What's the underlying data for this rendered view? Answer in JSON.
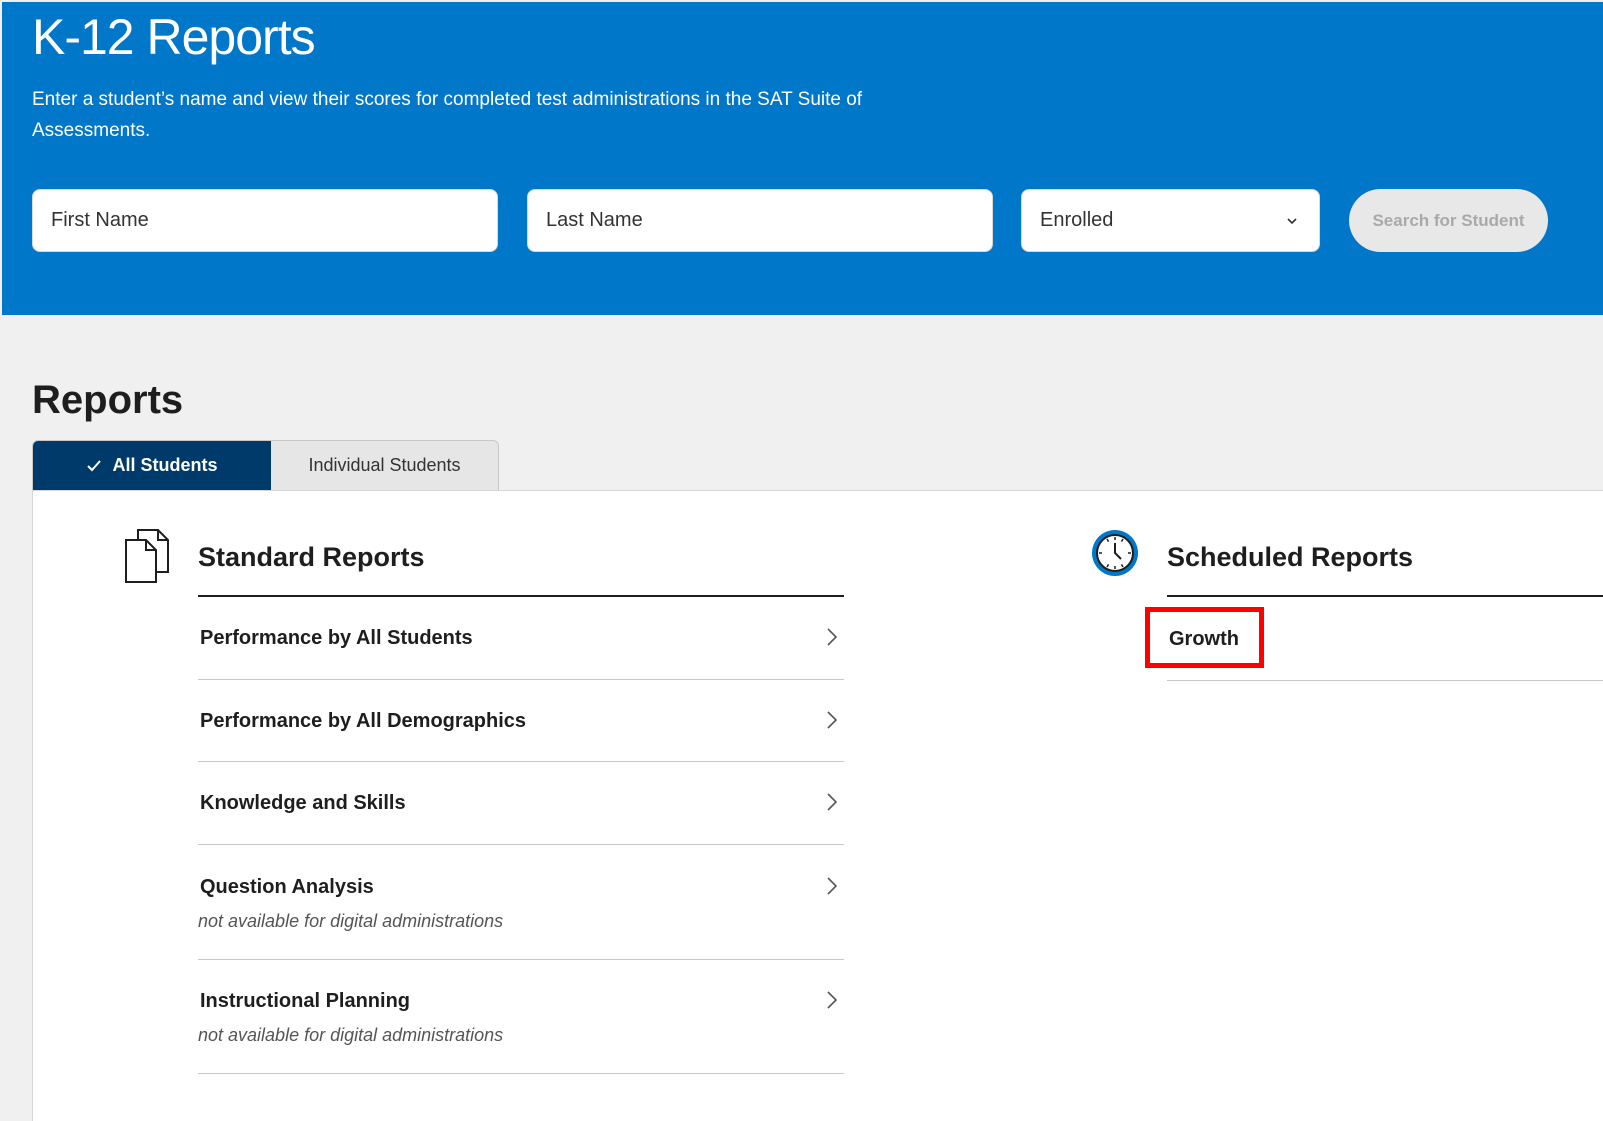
{
  "hero": {
    "title": "K-12 Reports",
    "description": "Enter a student’s name and view their scores for completed test administrations in the SAT Suite of Assessments.",
    "bg_color": "#0077c8"
  },
  "search": {
    "first_name_placeholder": "First Name",
    "last_name_placeholder": "Last Name",
    "status_selected": "Enrolled",
    "search_button_label": "Search for Student"
  },
  "reports": {
    "title": "Reports",
    "tabs": [
      {
        "label": "All Students",
        "active": true
      },
      {
        "label": "Individual Students",
        "active": false
      }
    ],
    "standard": {
      "title": "Standard Reports",
      "icon": "documents-icon",
      "items": [
        {
          "label": "Performance by All Students",
          "note": ""
        },
        {
          "label": "Performance by All Demographics",
          "note": ""
        },
        {
          "label": "Knowledge and Skills",
          "note": ""
        },
        {
          "label": "Question Analysis",
          "note": "not available for digital administrations"
        },
        {
          "label": "Instructional Planning",
          "note": "not available for digital administrations"
        }
      ]
    },
    "scheduled": {
      "title": "Scheduled Reports",
      "icon": "clock-icon",
      "items": [
        {
          "label": "Growth",
          "highlighted": true
        }
      ]
    }
  },
  "colors": {
    "accent_blue": "#0077c8",
    "active_tab": "#003a6a",
    "highlight": "#ff0000"
  }
}
